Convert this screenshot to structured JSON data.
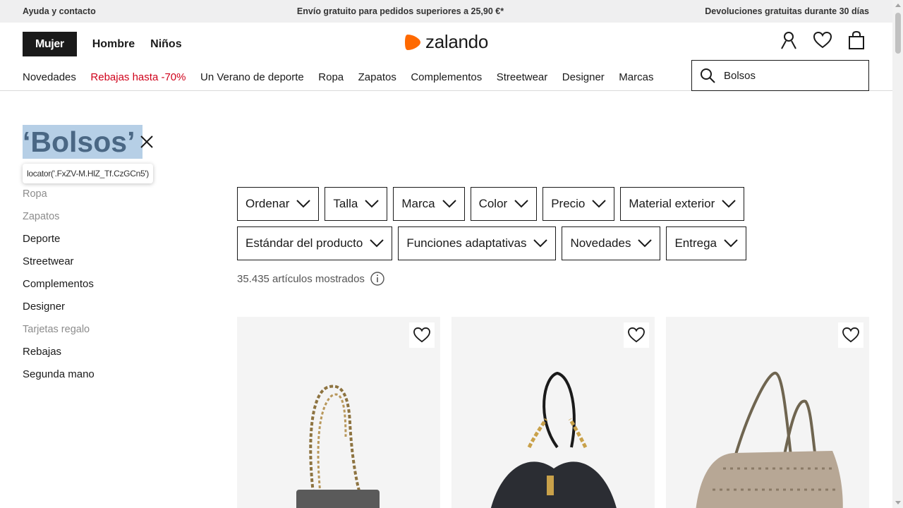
{
  "topbar": {
    "help": "Ayuda y contacto",
    "shipping": "Envío gratuito para pedidos superiores a 25,90 €*",
    "returns": "Devoluciones gratuitas durante 30 días"
  },
  "header": {
    "genders": [
      "Mujer",
      "Hombre",
      "Niños"
    ],
    "active_gender": "Mujer",
    "logo_text": "zalando",
    "categories": [
      "Novedades",
      "Rebajas hasta -70%",
      "Un Verano de deporte",
      "Ropa",
      "Zapatos",
      "Complementos",
      "Streetwear",
      "Designer",
      "Marcas"
    ],
    "search_value": "Bolsos",
    "icons": [
      "account-icon",
      "wishlist-heart-icon",
      "cart-bag-icon"
    ]
  },
  "search_title": "‘Bolsos’",
  "tooltip_text": "locator('.FxZV-M.HlZ_Tf.CzGCn5')",
  "sidebar": {
    "items": [
      {
        "label": "Ropa",
        "muted": true
      },
      {
        "label": "Zapatos",
        "muted": true
      },
      {
        "label": "Deporte",
        "muted": false
      },
      {
        "label": "Streetwear",
        "muted": false
      },
      {
        "label": "Complementos",
        "muted": false
      },
      {
        "label": "Designer",
        "muted": false
      },
      {
        "label": "Tarjetas regalo",
        "muted": true
      },
      {
        "label": "Rebajas",
        "muted": false
      },
      {
        "label": "Segunda mano",
        "muted": false
      }
    ]
  },
  "filters": {
    "row1": [
      "Ordenar",
      "Talla",
      "Marca",
      "Color",
      "Precio",
      "Material exterior"
    ],
    "row2": [
      "Estándar del producto",
      "Funciones adaptativas",
      "Novedades",
      "Entrega"
    ]
  },
  "results_count": "35.435 artículos mostrados",
  "colors": {
    "brand_orange": "#ff6900",
    "sale_red": "#d0021b",
    "selection_highlight": "#b6cfe6"
  }
}
